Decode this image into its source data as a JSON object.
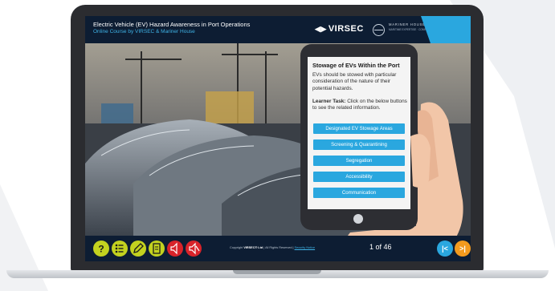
{
  "course": {
    "title": "Electric Vehicle (EV) Hazard Awareness in Port Operations",
    "subtitle": "Online Course by VIRSEC & Mariner House"
  },
  "logos": {
    "virsec": "VIRSEC",
    "mariner_house": "MARINER HOUSE",
    "mariner_tagline": "MARITIME EXPERTISE · COMPLIANCE TRAINING"
  },
  "panel": {
    "heading": "Stowage of EVs Within the Port",
    "body": "EVs should be stowed with particular consideration of the nature of their potential hazards.",
    "task_label": "Learner Task:",
    "task_text": " Click on the below buttons to see the related information.",
    "buttons": [
      "Designated EV Stowage Areas",
      "Screening & Quarantining",
      "Segregation",
      "Accessibility",
      "Communication"
    ]
  },
  "footer": {
    "copyright_prefix": "Copyright ",
    "copyright_brand": "VIRSEC® Ltd",
    "copyright_suffix": " | All Rights Reserved | ",
    "security_link": "Security Notice",
    "page_indicator": "1 of 46",
    "help_symbol": "?",
    "prev_symbol": "|<",
    "next_symbol": ">|"
  },
  "colors": {
    "accent": "#2aa7df",
    "header_bg": "#0d1d33",
    "help_yellow": "#c3d21f",
    "audio_red": "#d8232a",
    "next_orange": "#f39a1e"
  },
  "icons": [
    "help-icon",
    "menu-list-icon",
    "pencil-icon",
    "transcript-icon",
    "audio-on-icon",
    "audio-off-icon",
    "first-page-icon",
    "next-page-icon"
  ]
}
